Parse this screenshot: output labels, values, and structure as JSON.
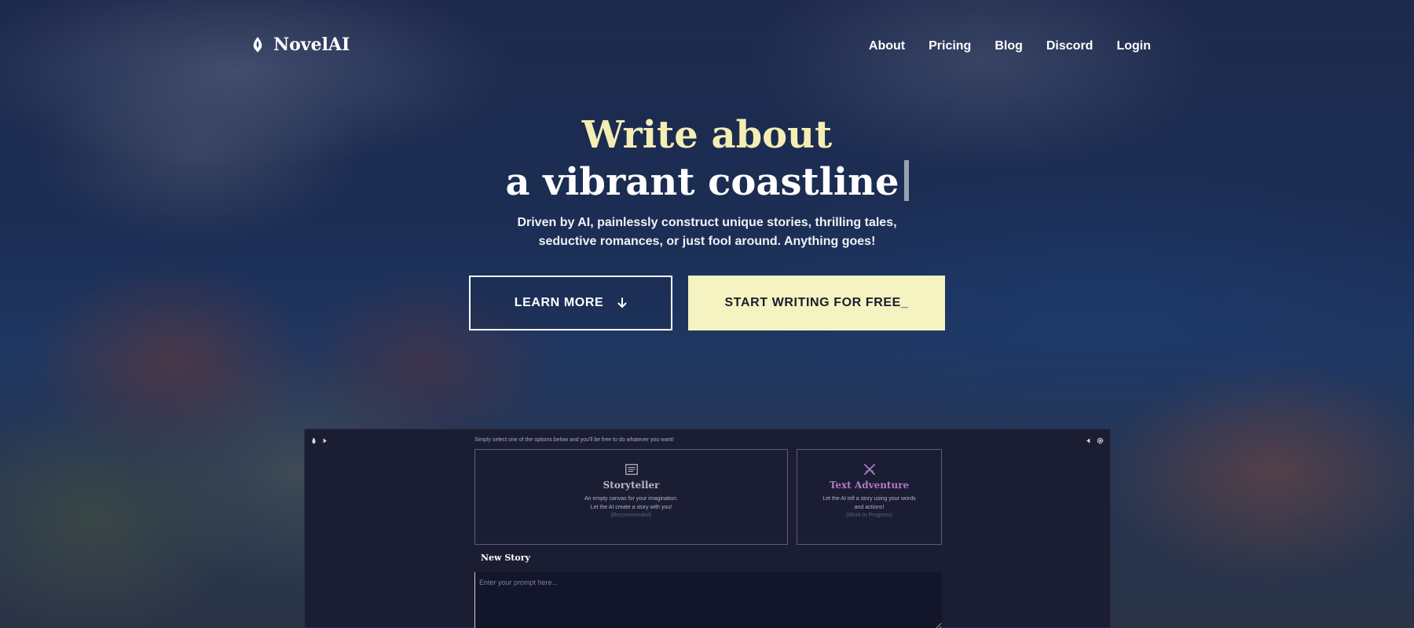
{
  "brand": {
    "name": "NovelAI",
    "icon": "novelai-quill-icon"
  },
  "nav": {
    "items": [
      {
        "label": "About"
      },
      {
        "label": "Pricing"
      },
      {
        "label": "Blog"
      },
      {
        "label": "Discord"
      },
      {
        "label": "Login"
      }
    ]
  },
  "hero": {
    "title_line1": "Write about",
    "title_line2": "a vibrant coastline",
    "subtitle_line1": "Driven by AI, painlessly construct unique stories, thrilling tales,",
    "subtitle_line2": "seductive romances, or just fool around. Anything goes!",
    "learn_more_label": "LEARN MORE",
    "start_label": "START WRITING FOR FREE_"
  },
  "preview": {
    "hint": "Simply select one of the options below and you'll be free to do whatever you want!",
    "storyteller": {
      "title": "Storyteller",
      "desc_line1": "An empty canvas for your imagination.",
      "desc_line2": "Let the AI create a story with you!",
      "note": "(Recommended)"
    },
    "adventure": {
      "title": "Text Adventure",
      "desc_line1": "Let the AI tell a story using your words",
      "desc_line2": "and actions!",
      "note": "(Work In Progress)"
    },
    "new_story_label": "New Story",
    "prompt_placeholder": "Enter your prompt here..."
  },
  "colors": {
    "accent_yellow": "#f5eeb4",
    "button_yellow": "#f5f3c1",
    "panel_bg": "#1b1d33",
    "adventure_purple": "#b07cc6"
  }
}
